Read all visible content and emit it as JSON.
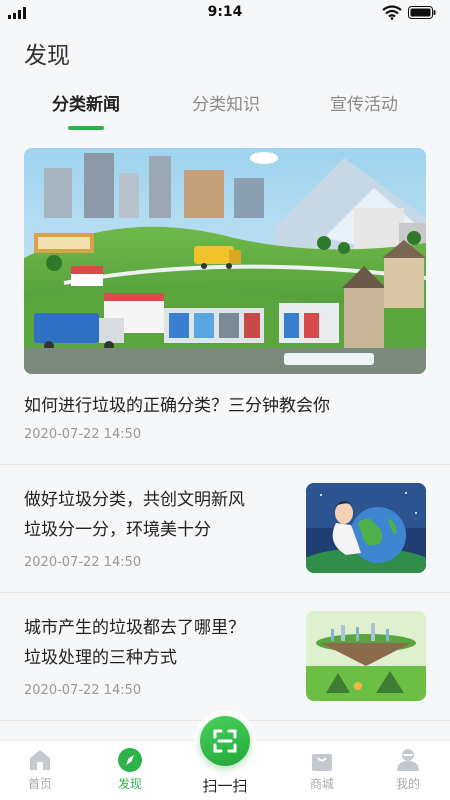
{
  "status_bar": {
    "time": "9:14"
  },
  "page_title": "发现",
  "tabs": [
    {
      "label": "分类新闻",
      "active": true
    },
    {
      "label": "分类知识",
      "active": false
    },
    {
      "label": "宣传活动",
      "active": false
    }
  ],
  "featured": {
    "title": "如何进行垃圾的正确分类？三分钟教会你",
    "date": "2020-07-22 14:50"
  },
  "news": [
    {
      "lines": [
        "做好垃圾分类，共创文明新风",
        "垃圾分一分，环境美十分"
      ],
      "date": "2020-07-22 14:50"
    },
    {
      "lines": [
        "城市产生的垃圾都去了哪里？",
        "垃圾处理的三种方式"
      ],
      "date": "2020-07-22 14:50"
    }
  ],
  "tabbar": {
    "home": "首页",
    "discover": "发现",
    "scan": "扫一扫",
    "mall": "商城",
    "mine": "我的"
  },
  "colors": {
    "accent": "#2db34a"
  }
}
